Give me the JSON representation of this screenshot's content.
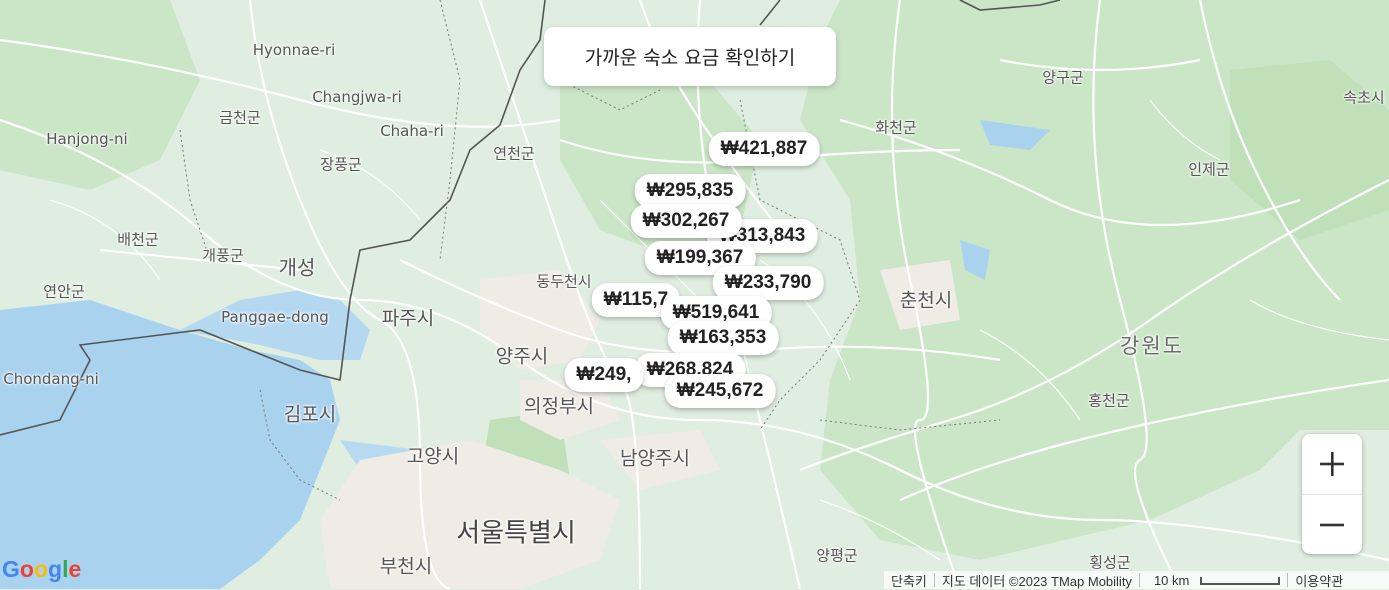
{
  "banner": {
    "label": "가까운 숙소 요금 확인하기"
  },
  "place_labels": [
    {
      "id": "hyonnae",
      "text": "Hyonnae-ri"
    },
    {
      "id": "changjwa",
      "text": "Changjwa-ri"
    },
    {
      "id": "chaha",
      "text": "Chaha-ri"
    },
    {
      "id": "geumcheon",
      "text": "금천군"
    },
    {
      "id": "hanjong",
      "text": "Hanjong-ni"
    },
    {
      "id": "jangpung",
      "text": "장풍군"
    },
    {
      "id": "yeoncheon",
      "text": "연천군"
    },
    {
      "id": "baecheon",
      "text": "배천군"
    },
    {
      "id": "gaepung",
      "text": "개풍군"
    },
    {
      "id": "gaeseong",
      "text": "개성"
    },
    {
      "id": "yeonan",
      "text": "연안군"
    },
    {
      "id": "panggae",
      "text": "Panggae-dong"
    },
    {
      "id": "paju",
      "text": "파주시"
    },
    {
      "id": "dongducheon",
      "text": "동두천시"
    },
    {
      "id": "yangju",
      "text": "양주시"
    },
    {
      "id": "chondang",
      "text": "Chondang-ni"
    },
    {
      "id": "gimpo",
      "text": "김포시"
    },
    {
      "id": "uijeongbu",
      "text": "의정부시"
    },
    {
      "id": "goyang",
      "text": "고양시"
    },
    {
      "id": "namyangju",
      "text": "남양주시"
    },
    {
      "id": "seoul",
      "text": "서울특별시"
    },
    {
      "id": "bucheon",
      "text": "부천시"
    },
    {
      "id": "yangpyeong",
      "text": "양평군"
    },
    {
      "id": "hwacheon",
      "text": "화천군"
    },
    {
      "id": "yanggu",
      "text": "양구군"
    },
    {
      "id": "inje",
      "text": "인제군"
    },
    {
      "id": "sokcho",
      "text": "속초시"
    },
    {
      "id": "chuncheon",
      "text": "춘천시"
    },
    {
      "id": "gangwon",
      "text": "강원도"
    },
    {
      "id": "hongcheon",
      "text": "홍천군"
    },
    {
      "id": "hoengseong",
      "text": "횡성군"
    }
  ],
  "prices": [
    {
      "id": "p1",
      "text": "₩421,887"
    },
    {
      "id": "p2",
      "text": "₩295,835"
    },
    {
      "id": "p3",
      "text": "₩313,843"
    },
    {
      "id": "p4",
      "text": "₩302,267"
    },
    {
      "id": "p5",
      "text": "₩199,367"
    },
    {
      "id": "p6",
      "text": "₩233,790"
    },
    {
      "id": "p7",
      "text": "₩115,7"
    },
    {
      "id": "p8",
      "text": "₩519,641"
    },
    {
      "id": "p9",
      "text": "₩163,353"
    },
    {
      "id": "p10",
      "text": "₩249,"
    },
    {
      "id": "p11",
      "text": "₩245,672"
    },
    {
      "id": "p12",
      "text": "₩268,824"
    }
  ],
  "zoom": {
    "in_symbol": "+",
    "out_symbol": "−"
  },
  "footer": {
    "shortcuts": "단축키",
    "map_data": "지도 데이터 ©2023 TMap Mobility",
    "scale": "10 km",
    "terms": "이용약관"
  },
  "google_logo": "Google",
  "colors": {
    "land": "#dfeee0",
    "forest": "#c9e5c6",
    "water": "#a9d2ef",
    "urban": "#f0ede8",
    "road": "#ffffff",
    "border": "#555555"
  }
}
